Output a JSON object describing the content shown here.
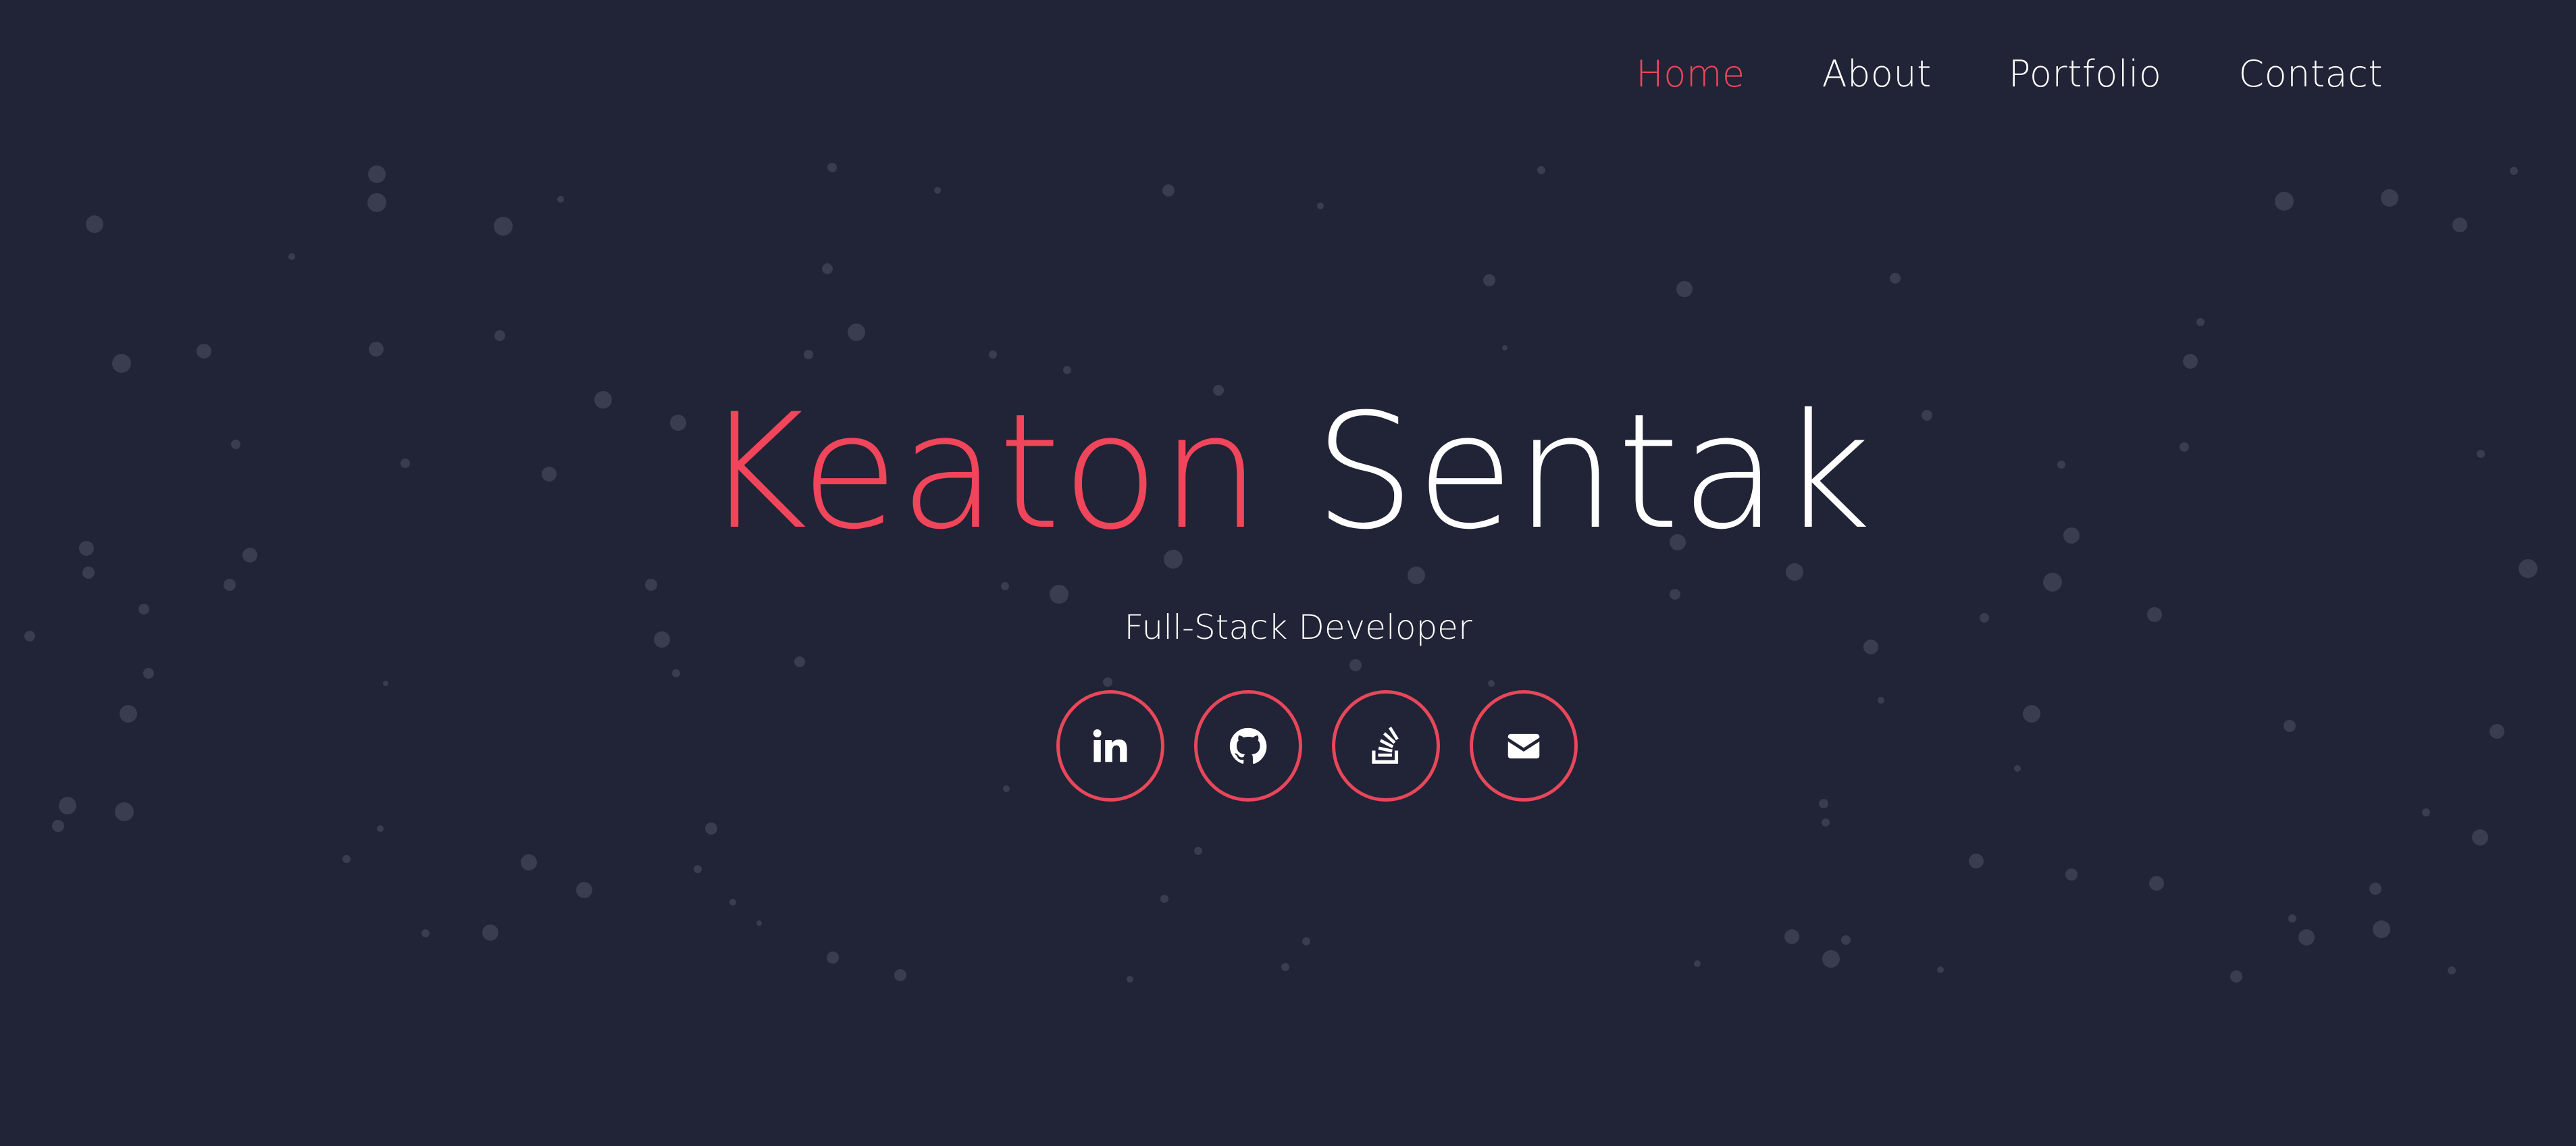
{
  "nav": {
    "items": [
      {
        "label": "Home",
        "active": true
      },
      {
        "label": "About",
        "active": false
      },
      {
        "label": "Portfolio",
        "active": false
      },
      {
        "label": "Contact",
        "active": false
      }
    ]
  },
  "hero": {
    "first_name": "Keaton",
    "last_name": "Sentak",
    "subtitle": "Full-Stack Developer"
  },
  "socials": [
    {
      "icon": "linkedin-icon"
    },
    {
      "icon": "github-icon"
    },
    {
      "icon": "stackoverflow-icon"
    },
    {
      "icon": "envelope-icon"
    }
  ],
  "colors": {
    "background": "#212336",
    "accent": "#f0455a",
    "text": "#ffffff",
    "particle": "#3a3c50"
  }
}
